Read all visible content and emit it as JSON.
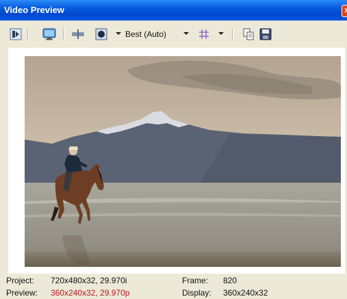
{
  "window": {
    "title": "Video Preview",
    "close_glyph": "✕"
  },
  "toolbar": {
    "tools": [
      {
        "name": "preview-settings-icon"
      },
      {
        "name": "external-monitor-icon"
      },
      {
        "name": "split-screen-icon"
      },
      {
        "name": "overlays-icon"
      },
      {
        "name": "grid-icon"
      },
      {
        "name": "copy-snapshot-icon"
      },
      {
        "name": "save-snapshot-icon"
      }
    ],
    "quality_label": "Best (Auto)"
  },
  "status": {
    "project_label": "Project:",
    "project_value": "720x480x32, 29.970i",
    "preview_label": "Preview:",
    "preview_value": "360x240x32, 29.970p",
    "frame_label": "Frame:",
    "frame_value": "820",
    "display_label": "Display:",
    "display_value": "360x240x32"
  },
  "colors": {
    "titlebar": "#0a56dc",
    "preview_value": "#c0141c"
  }
}
